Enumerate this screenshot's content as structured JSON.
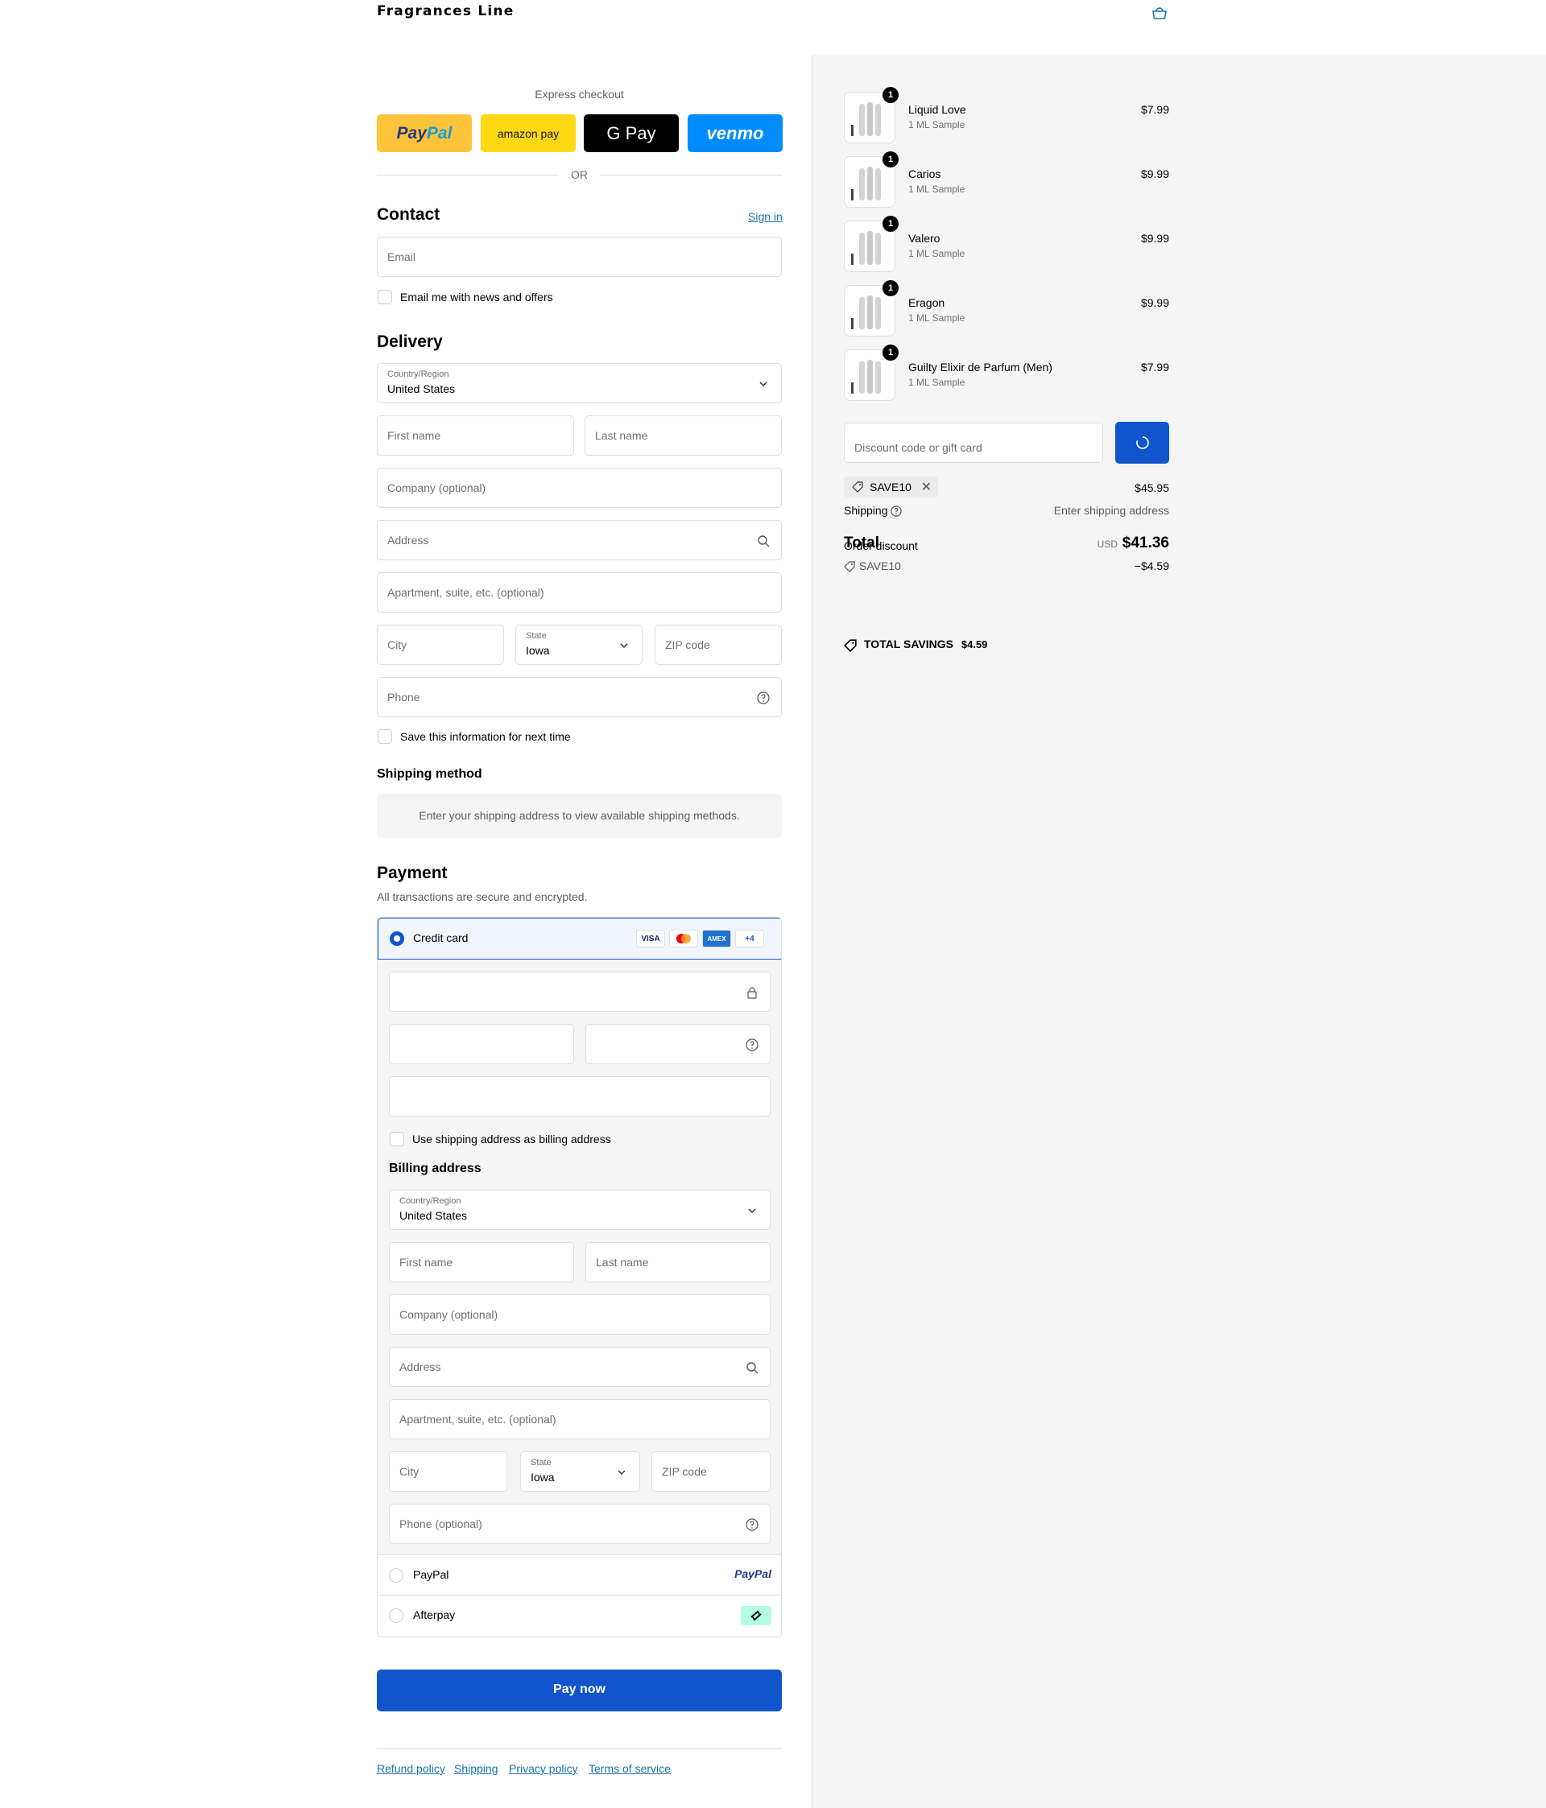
{
  "header": {
    "brand": "Fragrances Line",
    "cart_icon": "bag-icon"
  },
  "express": {
    "title": "Express checkout",
    "buttons": {
      "paypal_a": "Pay",
      "paypal_b": "Pal",
      "amazon": "amazon pay",
      "gpay": "G Pay",
      "venmo": "venmo"
    },
    "or": "OR"
  },
  "contact": {
    "title": "Contact",
    "sign_in": "Sign in",
    "email_placeholder": "Email",
    "newsletter": "Email me with news and offers"
  },
  "delivery": {
    "title": "Delivery",
    "country_label": "Country/Region",
    "country": "United States",
    "first_name": "First name",
    "last_name": "Last name",
    "company": "Company (optional)",
    "address": "Address",
    "apartment": "Apartment, suite, etc. (optional)",
    "city": "City",
    "state_label": "State",
    "state": "Iowa",
    "zip": "ZIP code",
    "phone": "Phone",
    "save_info": "Save this information for next time"
  },
  "shipping_method": {
    "title": "Shipping method",
    "message": "Enter your shipping address to view available shipping methods."
  },
  "payment": {
    "title": "Payment",
    "subtitle": "All transactions are secure and encrypted.",
    "credit_card": "Credit card",
    "cards": [
      "VISA",
      "MC",
      "AMEX",
      "+4"
    ],
    "use_shipping": "Use shipping address as billing address",
    "billing_title": "Billing address",
    "billing": {
      "country_label": "Country/Region",
      "country": "United States",
      "first_name": "First name",
      "last_name": "Last name",
      "company": "Company (optional)",
      "address": "Address",
      "apartment": "Apartment, suite, etc. (optional)",
      "city": "City",
      "state_label": "State",
      "state": "Iowa",
      "zip": "ZIP code",
      "phone": "Phone (optional)"
    },
    "paypal": "PayPal",
    "paypal_logo": "PayPal",
    "afterpay": "Afterpay"
  },
  "pay_now": "Pay now",
  "footer": [
    "Refund policy",
    "Shipping",
    "Privacy policy",
    "Terms of service"
  ],
  "summary": {
    "items": [
      {
        "name": "Liquid Love",
        "variant": "1 ML Sample",
        "price": "$7.99",
        "qty": "1"
      },
      {
        "name": "Carios",
        "variant": "1 ML Sample",
        "price": "$9.99",
        "qty": "1"
      },
      {
        "name": "Valero",
        "variant": "1 ML Sample",
        "price": "$9.99",
        "qty": "1"
      },
      {
        "name": "Eragon",
        "variant": "1 ML Sample",
        "price": "$9.99",
        "qty": "1"
      },
      {
        "name": "Guilty Elixir de Parfum (Men)",
        "variant": "1 ML Sample",
        "price": "$7.99",
        "qty": "1"
      }
    ],
    "discount_placeholder": "Discount code or gift card",
    "code": "SAVE10",
    "subtotal": "$45.95",
    "shipping_label": "Shipping",
    "shipping_value": "Enter shipping address",
    "total_label": "Total",
    "order_discount": "Order discount",
    "currency": "USD",
    "total": "$41.36",
    "discount_code": "SAVE10",
    "discount_amount": "−$4.59",
    "savings_label": "TOTAL SAVINGS",
    "savings_value": "$4.59"
  },
  "colors": {
    "accent": "#1155cc",
    "link": "#1773b0",
    "panel": "#f5f5f5"
  }
}
